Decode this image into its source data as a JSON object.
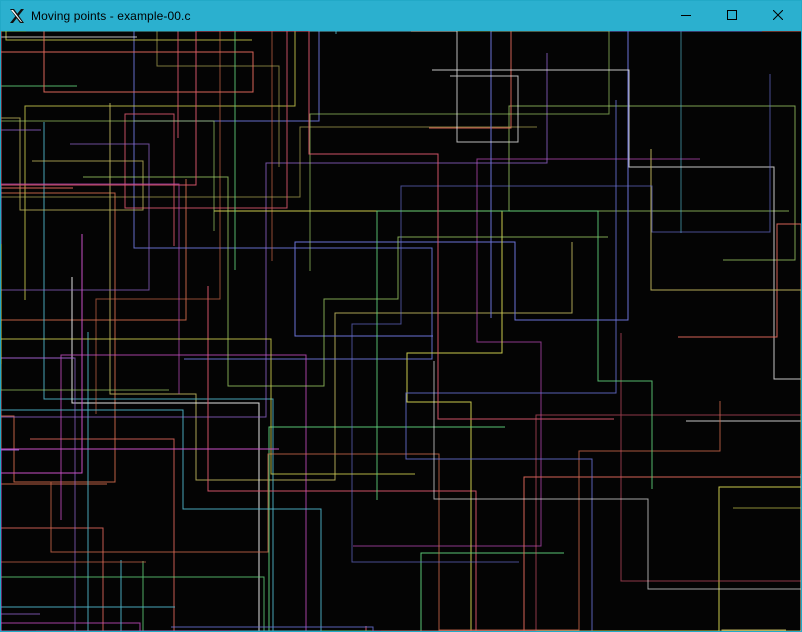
{
  "window": {
    "title": "Moving points - example-00.c",
    "icon": "x-window-system-icon",
    "title_bar_color": "#2bb0cf",
    "controls": [
      {
        "name": "minimize-button",
        "icon": "minimize-icon"
      },
      {
        "name": "maximize-button",
        "icon": "maximize-icon"
      },
      {
        "name": "close-button",
        "icon": "close-icon"
      }
    ]
  },
  "canvas": {
    "background": "#040404",
    "trail_colors": [
      "#e0675b",
      "#cf6a4c",
      "#b9b05a",
      "#4fb3c8",
      "#6a72d6",
      "#a4d46a",
      "#cfcf4f",
      "#c94fc6",
      "#e8e8e8",
      "#5fd07a",
      "#9a6ad6",
      "#d6556a"
    ]
  }
}
